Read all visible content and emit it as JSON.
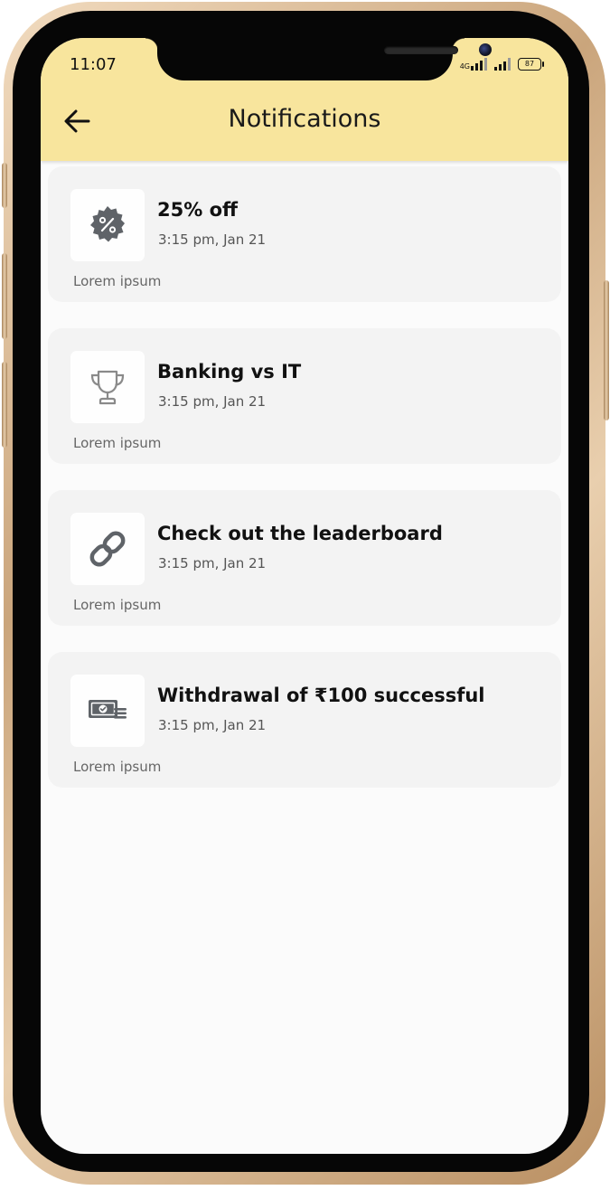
{
  "status_bar": {
    "time": "11:07",
    "network": "4G",
    "battery": "87"
  },
  "header": {
    "title": "Notifications",
    "back_icon": "arrow-left-icon",
    "background": "#f8e59d"
  },
  "notifications": [
    {
      "icon": "discount-badge-icon",
      "title": "25% off",
      "time": "3:15 pm, Jan 21",
      "description": "Lorem ipsum"
    },
    {
      "icon": "trophy-icon",
      "title": "Banking vs IT",
      "time": "3:15 pm, Jan 21",
      "description": "Lorem ipsum"
    },
    {
      "icon": "link-icon",
      "title": "Check out the leaderboard",
      "time": "3:15 pm, Jan 21",
      "description": "Lorem ipsum"
    },
    {
      "icon": "cash-withdrawal-icon",
      "title": "Withdrawal of ₹100 successful",
      "time": "3:15 pm, Jan 21",
      "description": "Lorem ipsum"
    }
  ]
}
